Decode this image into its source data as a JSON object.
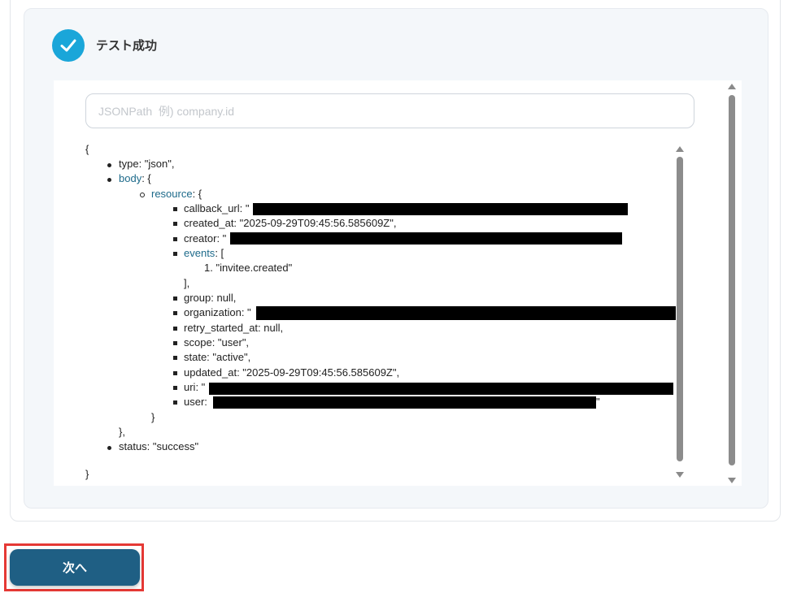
{
  "status": {
    "title": "テスト成功",
    "accent": "#1aa6d9"
  },
  "jsonpath": {
    "placeholder": "JSONPath  例) company.id",
    "value": ""
  },
  "tree": {
    "open_brace": "{",
    "type_line": "type: \"json\",",
    "body_key": "body",
    "body_open": ": {",
    "resource_key": "resource",
    "resource_open": ": {",
    "callback_url": "callback_url: \"",
    "created_at": "created_at: \"2025-09-29T09:45:56.585609Z\",",
    "creator": "creator: \"",
    "events_key": "events",
    "events_open": ": [",
    "events_item": "1. \"invitee.created\"",
    "events_close": "],",
    "group": "group: null,",
    "organization": "organization: \"",
    "retry_started_at": "retry_started_at: null,",
    "scope": "scope: \"user\",",
    "state": "state: \"active\",",
    "updated_at": "updated_at: \"2025-09-29T09:45:56.585609Z\",",
    "uri": "uri: \"",
    "user": "user: ",
    "user_tail": "\"",
    "resource_close": "}",
    "body_close": "},",
    "status_line": "status: \"success\"",
    "close_brace": "}"
  },
  "next_button": {
    "label": "次へ",
    "color": "#1f5f84"
  },
  "highlight_color": "#e53935"
}
